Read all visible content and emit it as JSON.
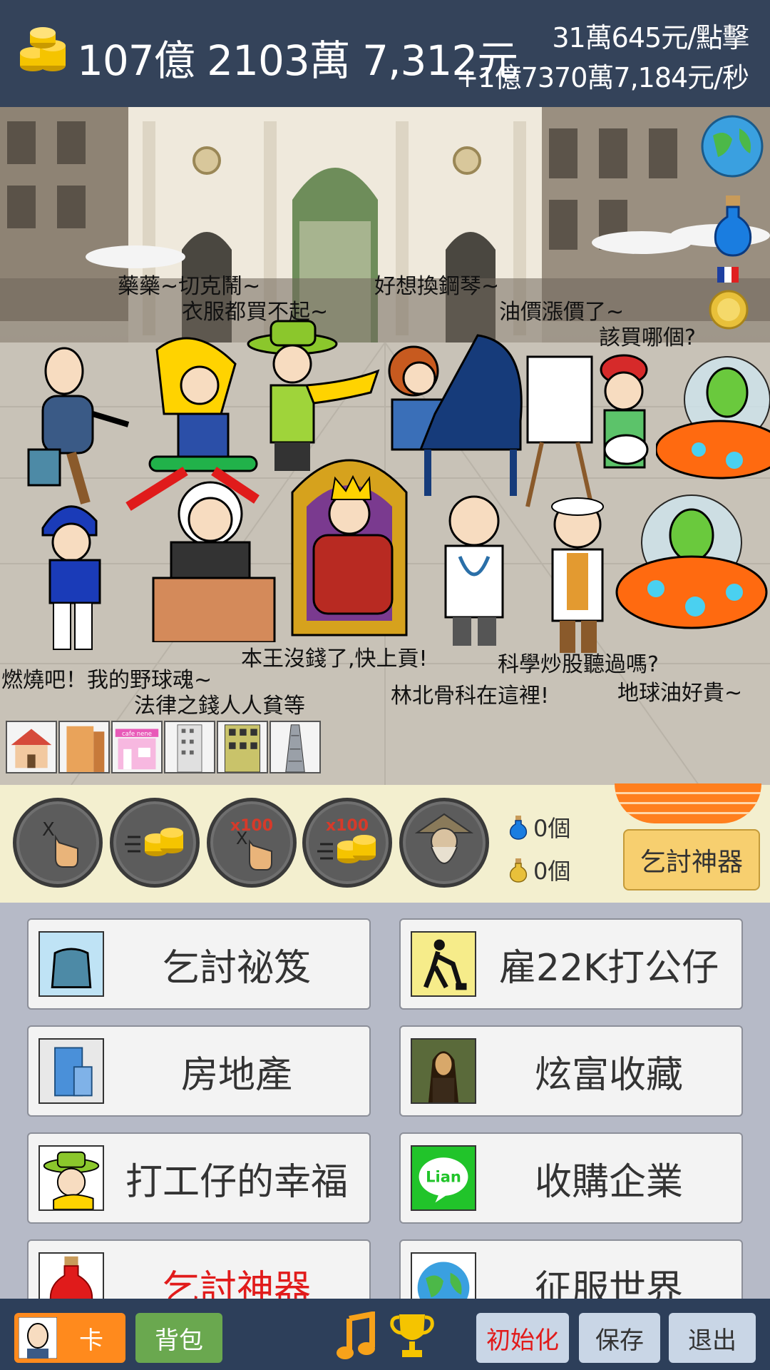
{
  "header": {
    "money_total": "107億 2103萬 7,312元",
    "per_click": "31萬645元/點擊",
    "per_second": "+1億7370萬7,184元/秒"
  },
  "scene": {
    "speech": [
      "藥藥~切克鬧~",
      "衣服都買不起~",
      "好想換鋼琴~",
      "油價漲價了~",
      "該買哪個?",
      "燃燒吧！我的野球魂~",
      "本王沒錢了,快上貢!",
      "法律之錢人人貧等",
      "林北骨科在這裡!",
      "科學炒股聽過嗎?",
      "地球油好貴~"
    ],
    "buildings": [
      "house",
      "apartment",
      "cafe",
      "office",
      "tower-office",
      "skyscraper"
    ],
    "cafe_sign": "cafe nene"
  },
  "boosts": {
    "multiplier": "x100",
    "potion_blue_count": "0個",
    "potion_gold_count": "0個",
    "god_button": "乞討神器"
  },
  "menu": {
    "items": [
      {
        "label": "乞討祕笈",
        "icon": "beggar-bowl-icon"
      },
      {
        "label": "雇22K打公仔",
        "icon": "worker-shovel-icon"
      },
      {
        "label": "房地產",
        "icon": "building-icon"
      },
      {
        "label": "炫富收藏",
        "icon": "mona-lisa-icon"
      },
      {
        "label": "打工仔的幸福",
        "icon": "worker-face-icon"
      },
      {
        "label": "收購企業",
        "icon": "lian-app-icon"
      },
      {
        "label": "乞討神器",
        "icon": "potion-icon"
      },
      {
        "label": "征服世界",
        "icon": "globe-icon"
      }
    ],
    "lian_text": "Lian"
  },
  "bottom": {
    "card": "卡",
    "bag": "背包",
    "init": "初始化",
    "save": "保存",
    "exit": "退出"
  },
  "colors": {
    "header_bg": "#34435a",
    "boost_bg": "#f3efcf",
    "menu_bg": "#b6bac7",
    "accent_orange": "#ff8a1d",
    "accent_green": "#6aa84f",
    "red_text": "#e11b1b"
  }
}
